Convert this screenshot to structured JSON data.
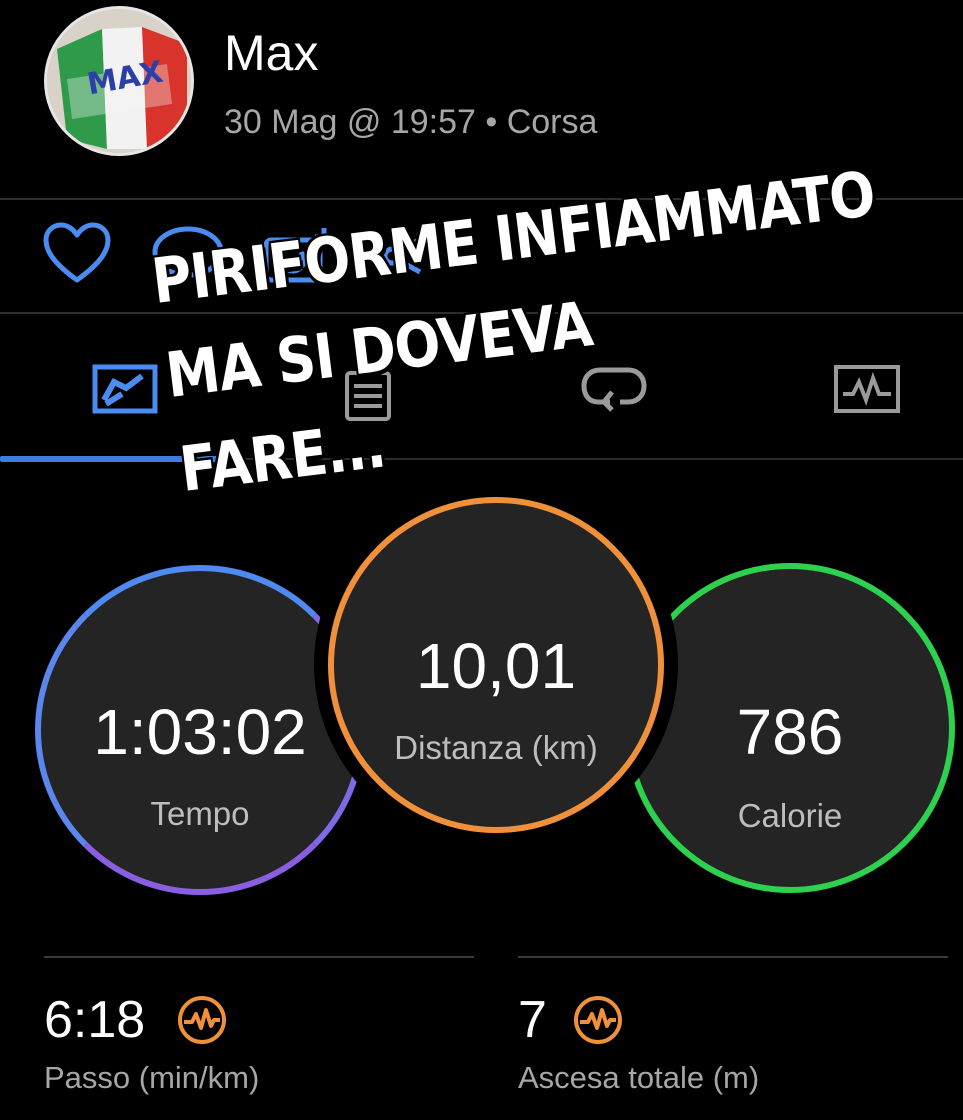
{
  "user": {
    "name": "Max",
    "date_time": "30 Mag @ 19:57",
    "separator": "•",
    "activity_type": "Corsa",
    "avatar_text": "MAX"
  },
  "actions": [
    {
      "icon": "heart-icon"
    },
    {
      "icon": "comment-icon"
    },
    {
      "icon": "add-photo-icon"
    },
    {
      "icon": "share-icon"
    }
  ],
  "tabs": [
    {
      "icon": "overview-map-icon",
      "active": true
    },
    {
      "icon": "details-list-icon",
      "active": false
    },
    {
      "icon": "laps-icon",
      "active": false
    },
    {
      "icon": "charts-icon",
      "active": false
    }
  ],
  "overlay": {
    "line1": "PIRIFORME INFIAMMATO",
    "line2": "MA SI DOVEVA",
    "line3": "FARE..."
  },
  "stats_main": {
    "tempo": {
      "value": "1:03:02",
      "label": "Tempo",
      "color": "#5a86ee"
    },
    "distanza": {
      "value": "10,01",
      "label": "Distanza (km)",
      "color": "#f0903a"
    },
    "calorie": {
      "value": "786",
      "label": "Calorie",
      "color": "#2ed14d"
    }
  },
  "stats_secondary": {
    "passo": {
      "value": "6:18",
      "label": "Passo (min/km)",
      "icon": "activity-pulse-icon"
    },
    "ascesa": {
      "value": "7",
      "label": "Ascesa totale (m)",
      "icon": "activity-pulse-icon"
    }
  },
  "colors": {
    "accent_blue": "#3d7ee0",
    "accent_orange": "#f0903a"
  }
}
